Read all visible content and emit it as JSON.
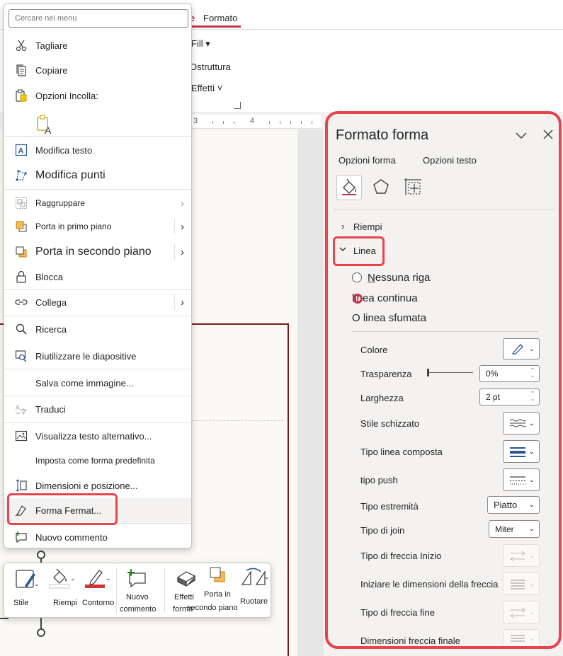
{
  "ribbon": {
    "tab_fragment": "e",
    "active_tab": "Formato",
    "fill_label": "Fill",
    "outline_label": "Ostruttura",
    "effects_label": "Effetti"
  },
  "ruler": {
    "num_3": "3",
    "num_4": "4"
  },
  "context_menu": {
    "search_placeholder": "Cercare nei menu",
    "items": {
      "cut": "Tagliare",
      "copy": "Copiare",
      "paste_options": "Opzioni Incolla:",
      "edit_text": "Modifica testo",
      "edit_points": "Modifica punti",
      "group": "Raggruppare",
      "bring_front": "Porta in primo piano",
      "send_back": "Porta in secondo piano",
      "lock": "Blocca",
      "link": "Collega",
      "search": "Ricerca",
      "reuse_slides": "Riutilizzare le diapositive",
      "save_as_image": "Salva come immagine...",
      "translate": "Traduci",
      "view_alt_text": "Visualizza testo alternativo...",
      "set_default_shape": "Imposta come forma predefinita",
      "size_position": "Dimensioni e posizione...",
      "format_shape": "Forma Fermat...",
      "new_comment": "Nuovo commento"
    }
  },
  "mini_toolbar": {
    "style": "Stile",
    "fill": "Riempi",
    "outline": "Contorno",
    "new_comment_l1": "Nuovo",
    "new_comment_l2": "commento",
    "shape_effects_l1": "Effetti",
    "shape_effects_l2": "forma",
    "send_back_l1": "Porta in",
    "send_back_l2": "secondo piano",
    "rotate": "Ruotare",
    "outline_color": "#d13438"
  },
  "format_pane": {
    "title": "Formato forma",
    "tab_shape_options": "Opzioni forma",
    "tab_text_options": "Opzioni testo",
    "section_fill": "Riempi",
    "section_line": "Linea",
    "radio_no_line": "Nessuna riga",
    "radio_solid_line": "linea continua",
    "radio_gradient_line": "O linea sfumata",
    "radio_no_line_accel": "N",
    "radio_no_line_rest": "essuna riga",
    "props": {
      "color": "Colore",
      "transparency": "Trasparenza",
      "transparency_value": "0%",
      "width": "Larghezza",
      "width_value": "2 pt",
      "sketch_style": "Stile schizzato",
      "compound_type": "Tipo linea composta",
      "dash_type": "tipo push",
      "cap_type": "Tipo estremità",
      "cap_value": "Piatto",
      "join_type": "Tipo di join",
      "join_value": "Miter",
      "begin_arrow_type": "Tipo di freccia Inizio",
      "begin_arrow_size": "Iniziare le dimensioni della freccia",
      "end_arrow_type": "Tipo di freccia fine",
      "end_arrow_size": "Dimensioni freccia finale"
    }
  },
  "colors": {
    "highlight_red": "#e8444d",
    "accent_blue": "#2b579a",
    "slide_border": "#7a1a22"
  }
}
